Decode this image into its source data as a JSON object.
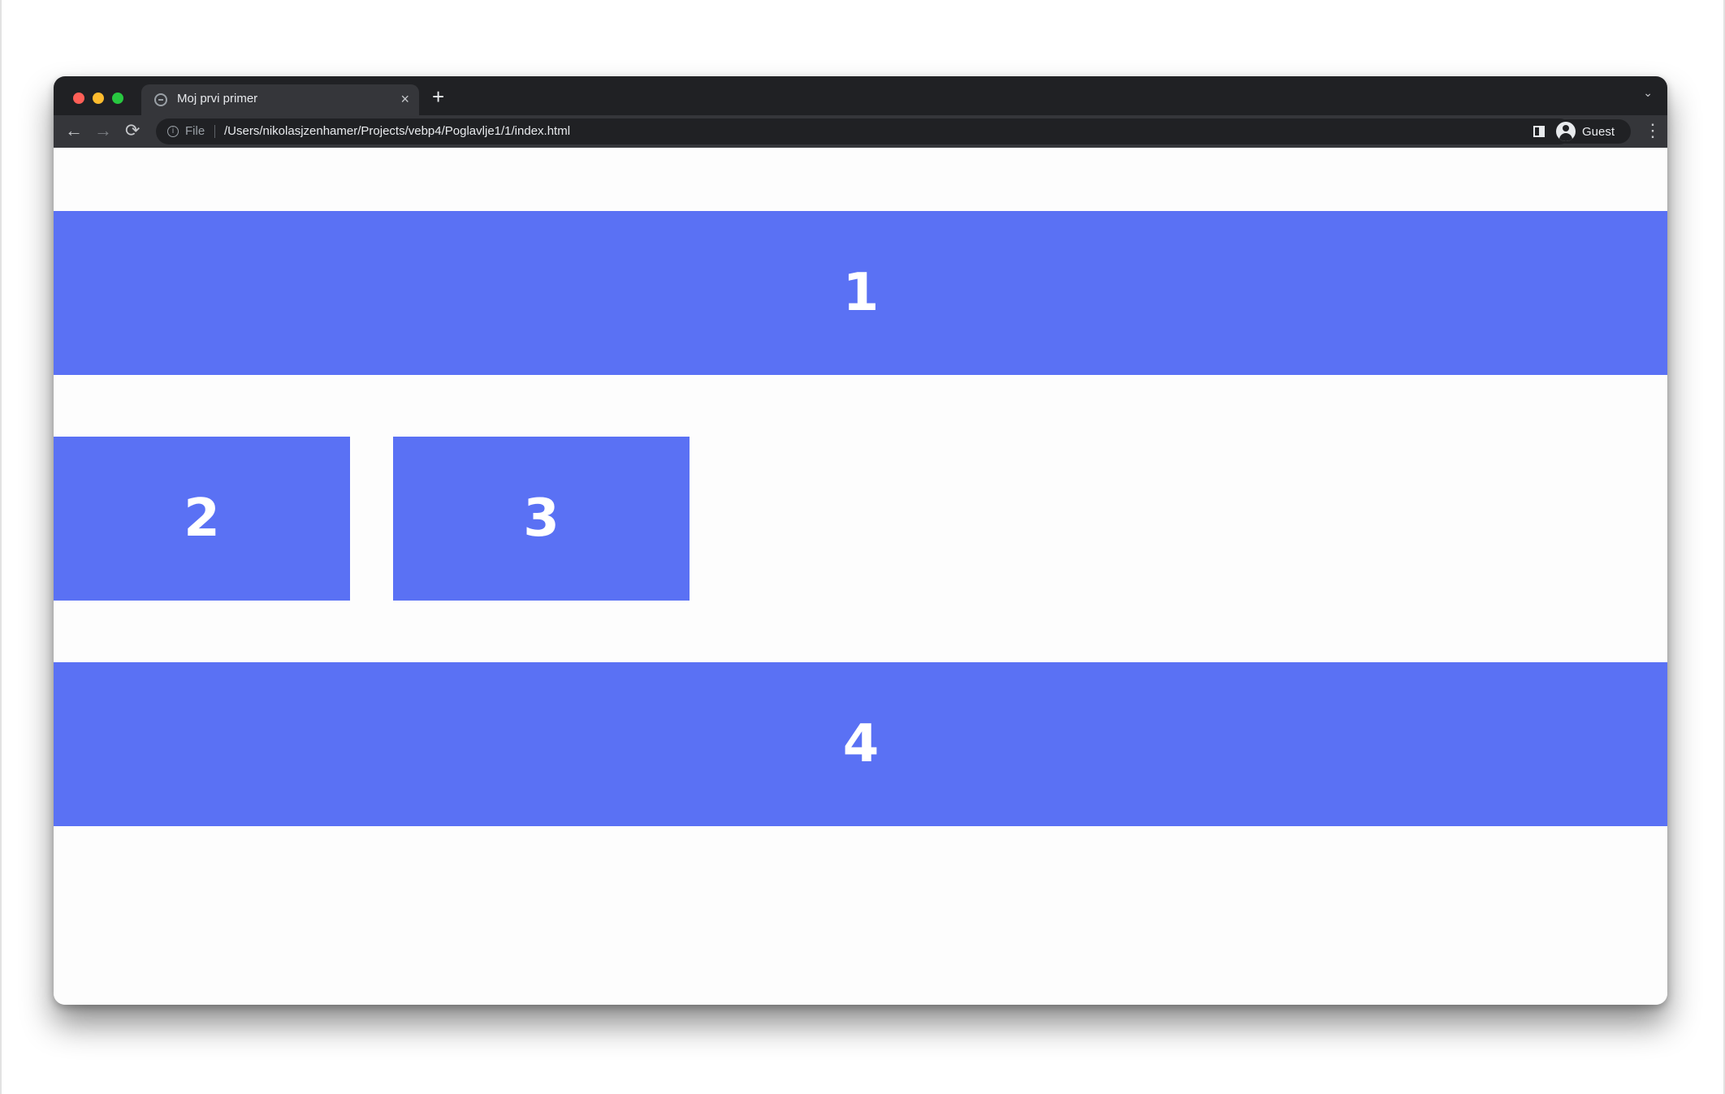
{
  "browser": {
    "tab": {
      "title": "Moj prvi primer",
      "close_glyph": "×",
      "favicon": "globe-icon"
    },
    "new_tab_glyph": "+",
    "tab_search_glyph": "⌄",
    "nav": {
      "back_glyph": "←",
      "forward_glyph": "→",
      "reload_glyph": "⟳"
    },
    "address": {
      "scheme_label": "File",
      "info_glyph": "i",
      "url": "/Users/nikolasjzenhamer/Projects/vebp4/Poglavlje1/1/index.html"
    },
    "profile": {
      "name": "Guest"
    },
    "menu_glyph": "⋮"
  },
  "page": {
    "box_color": "#5a71f4",
    "boxes": [
      {
        "label": "1"
      },
      {
        "label": "2"
      },
      {
        "label": "3"
      },
      {
        "label": "4"
      }
    ]
  }
}
